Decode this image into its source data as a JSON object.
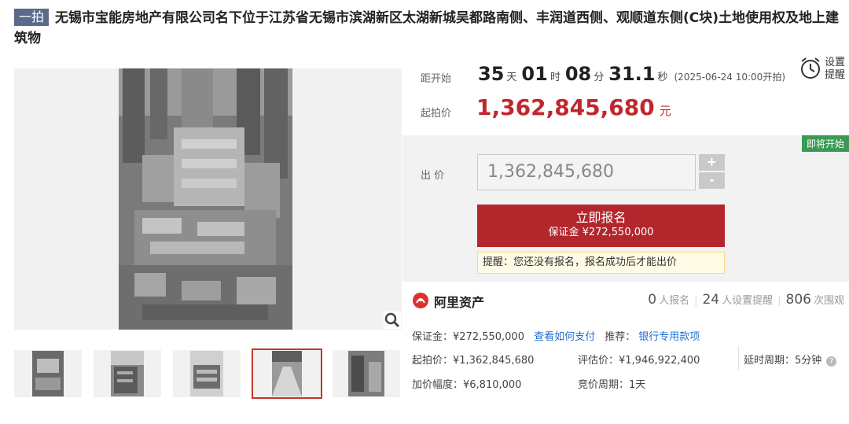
{
  "title": {
    "tag": "一拍",
    "text": "无锡市宝能房地产有限公司名下位于江苏省无锡市滨湖新区太湖新城吴都路南侧、丰润道西侧、观顺道东侧(C块)土地使用权及地上建筑物"
  },
  "countdown": {
    "label": "距开始",
    "days": "35",
    "days_unit": "天",
    "hours": "01",
    "hours_unit": "时",
    "minutes": "08",
    "minutes_unit": "分",
    "seconds": "31.1",
    "seconds_unit": "秒",
    "start_time": "(2025-06-24 10:00开拍)"
  },
  "remind": {
    "line1": "设置",
    "line2": "提醒",
    "icon": "alarm-clock-icon"
  },
  "start_price": {
    "label": "起拍价",
    "value": "1,362,845,680",
    "unit": "元"
  },
  "bid": {
    "status_badge": "即将开始",
    "label": "出 价",
    "value": "1,362,845,680",
    "plus": "+",
    "minus": "-",
    "signup_title": "立即报名",
    "signup_deposit": "保证金 ¥272,550,000",
    "tip": "提醒：您还没有报名，报名成功后才能出价"
  },
  "platform": {
    "name": "阿里资产",
    "icon": "ali-asset-logo-icon"
  },
  "stats": {
    "signup_count": "0",
    "signup_label": "人报名",
    "remind_count": "24",
    "remind_label": "人设置提醒",
    "view_count": "806",
    "view_label": "次围观"
  },
  "details": {
    "deposit": "保证金：¥272,550,000",
    "pay_link": "查看如何支付",
    "recommend_label": "推荐：",
    "recommend_link": "银行专用款项",
    "start_price": "起拍价：¥1,362,845,680",
    "appraisal": "评估价：¥1,946,922,400",
    "delay": "延时周期：5分钟",
    "increment": "加价幅度：¥6,810,000",
    "cycle": "竞价周期：1天"
  },
  "colors": {
    "accent": "#c0272d",
    "badge": "#3a9a53",
    "link": "#1e6fd1",
    "tag": "#5a6a8a"
  },
  "gallery": {
    "thumb_count": 5,
    "active_index": 3
  }
}
